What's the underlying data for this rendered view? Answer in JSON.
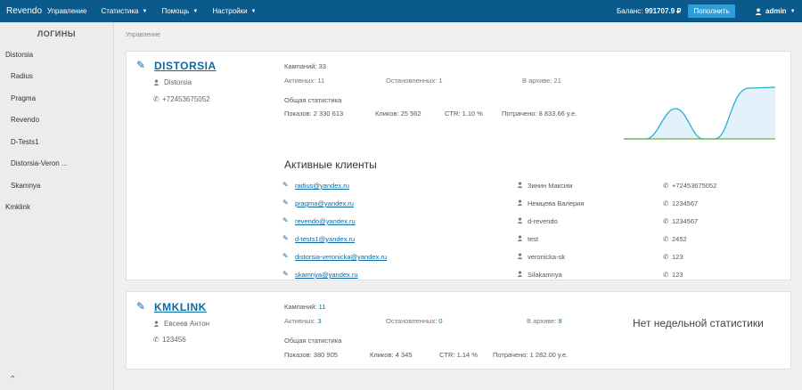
{
  "topbar": {
    "brand": "Revendo",
    "nav": [
      {
        "label": "Управление",
        "dropdown": false
      },
      {
        "label": "Статистика",
        "dropdown": true
      },
      {
        "label": "Помощь",
        "dropdown": true
      },
      {
        "label": "Настройки",
        "dropdown": true
      }
    ],
    "balance_label": "Баланс:",
    "balance_value": "991707.9 ₽",
    "topup_label": "Пополнить",
    "user": "admin"
  },
  "sidebar": {
    "title": "ЛОГИНЫ",
    "items": [
      "Distorsia",
      "Radius",
      "Pragma",
      "Revendo",
      "D-Tests1",
      "Distorsia-Veron ...",
      "Skamnya",
      "Kmklink"
    ]
  },
  "breadcrumb": "Управление",
  "accounts": [
    {
      "name": "DISTORSIA",
      "owner": "Distorsia",
      "phone": "+72453675052",
      "campaigns_label": "Кампаний:",
      "campaigns": "33",
      "active_label": "Активных:",
      "active": "11",
      "stopped_label": "Остановленных:",
      "stopped": "1",
      "archive_label": "В архиве:",
      "archive": "21",
      "stats_title": "Общая статистика",
      "shows_label": "Показов:",
      "shows": "2 330 613",
      "clicks_label": "Кликов:",
      "clicks": "25 562",
      "ctr_label": "CTR:",
      "ctr": "1.10 %",
      "spent_label": "Потрачено:",
      "spent": "8 833.66 у.е.",
      "clients_title": "Активные клиенты",
      "clients": [
        {
          "email": "radius@yandex.ru",
          "name": "Зинин Максим",
          "phone": "+72453675052"
        },
        {
          "email": "pragma@yandex.ru",
          "name": "Немцева Валерия",
          "phone": "1234567"
        },
        {
          "email": "revendo@yandex.ru",
          "name": "d-revendo",
          "phone": "1234567"
        },
        {
          "email": "d-tests1@yandex.ru",
          "name": "test",
          "phone": "2452"
        },
        {
          "email": "distorsia-veronicka@yandex.ru",
          "name": "veronicka-sk",
          "phone": "123"
        },
        {
          "email": "skamnya@yandex.ru",
          "name": "Silakamnya",
          "phone": "123"
        }
      ],
      "chart_colors": {
        "line": "#2aaed8",
        "fill": "#e3f1fa",
        "base": "#6ab04c"
      }
    },
    {
      "name": "KMKLINK",
      "owner": "Евсеев Антон",
      "phone": "123456",
      "campaigns_label": "Кампаний:",
      "campaigns": "11",
      "active_label": "Активных:",
      "active": "3",
      "stopped_label": "Остановленных:",
      "stopped": "0",
      "archive_label": "В архиве:",
      "archive": "8",
      "stats_title": "Общая статистика",
      "shows_label": "Показов:",
      "shows": "380 905",
      "clicks_label": "Кликов:",
      "clicks": "4 345",
      "ctr_label": "CTR:",
      "ctr": "1.14 %",
      "spent_label": "Потрачено:",
      "spent": "1 282.00 у.е.",
      "no_stats": "Нет недельной статистики"
    }
  ]
}
